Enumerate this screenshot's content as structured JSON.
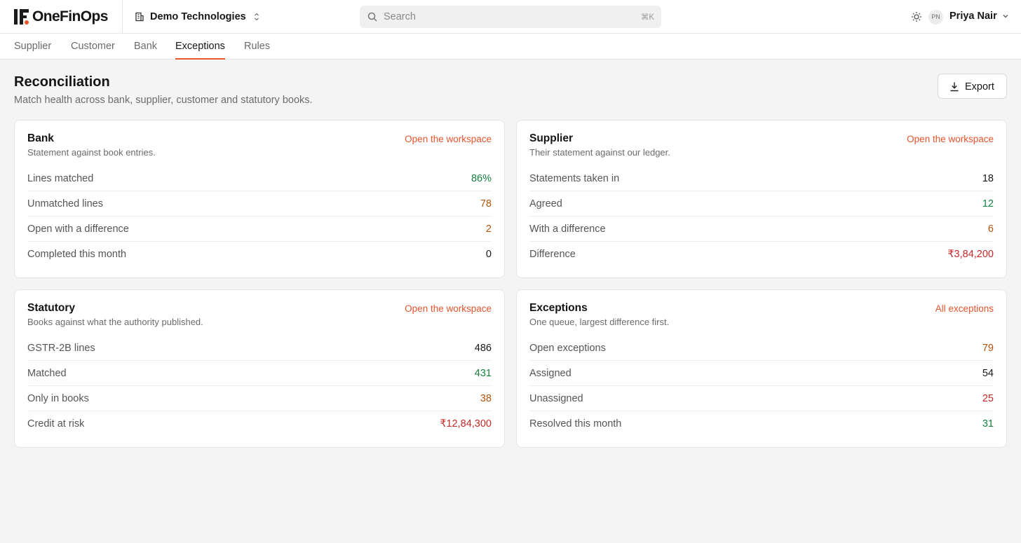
{
  "app": {
    "brand": "OneFinOps",
    "org_name": "Demo Technologies",
    "search_placeholder": "Search",
    "search_shortcut": "⌘K",
    "user_initials": "PN",
    "user_name": "Priya Nair",
    "accent": "#e8542c"
  },
  "tabs": [
    {
      "label": "Supplier",
      "active": false
    },
    {
      "label": "Customer",
      "active": false
    },
    {
      "label": "Bank",
      "active": false
    },
    {
      "label": "Exceptions",
      "active": true
    },
    {
      "label": "Rules",
      "active": false
    }
  ],
  "page": {
    "title": "Reconciliation",
    "subtitle": "Match health across bank, supplier, customer and statutory books.",
    "export_label": "Export"
  },
  "cards": {
    "bank": {
      "title": "Bank",
      "subtitle": "Statement against book entries.",
      "link": "Open the workspace",
      "rows": [
        {
          "label": "Lines matched",
          "value": "86%",
          "tone": "green"
        },
        {
          "label": "Unmatched lines",
          "value": "78",
          "tone": "amber"
        },
        {
          "label": "Open with a difference",
          "value": "2",
          "tone": "amber"
        },
        {
          "label": "Completed this month",
          "value": "0",
          "tone": "neutral"
        }
      ]
    },
    "supplier": {
      "title": "Supplier",
      "subtitle": "Their statement against our ledger.",
      "link": "Open the workspace",
      "rows": [
        {
          "label": "Statements taken in",
          "value": "18",
          "tone": "neutral"
        },
        {
          "label": "Agreed",
          "value": "12",
          "tone": "green"
        },
        {
          "label": "With a difference",
          "value": "6",
          "tone": "amber"
        },
        {
          "label": "Difference",
          "value": "₹3,84,200",
          "tone": "red"
        }
      ]
    },
    "statutory": {
      "title": "Statutory",
      "subtitle": "Books against what the authority published.",
      "link": "Open the workspace",
      "rows": [
        {
          "label": "GSTR-2B lines",
          "value": "486",
          "tone": "neutral"
        },
        {
          "label": "Matched",
          "value": "431",
          "tone": "green"
        },
        {
          "label": "Only in books",
          "value": "38",
          "tone": "amber"
        },
        {
          "label": "Credit at risk",
          "value": "₹12,84,300",
          "tone": "red"
        }
      ]
    },
    "exceptions": {
      "title": "Exceptions",
      "subtitle": "One queue, largest difference first.",
      "link": "All exceptions",
      "rows": [
        {
          "label": "Open exceptions",
          "value": "79",
          "tone": "amber"
        },
        {
          "label": "Assigned",
          "value": "54",
          "tone": "neutral"
        },
        {
          "label": "Unassigned",
          "value": "25",
          "tone": "red"
        },
        {
          "label": "Resolved this month",
          "value": "31",
          "tone": "green"
        }
      ]
    }
  }
}
